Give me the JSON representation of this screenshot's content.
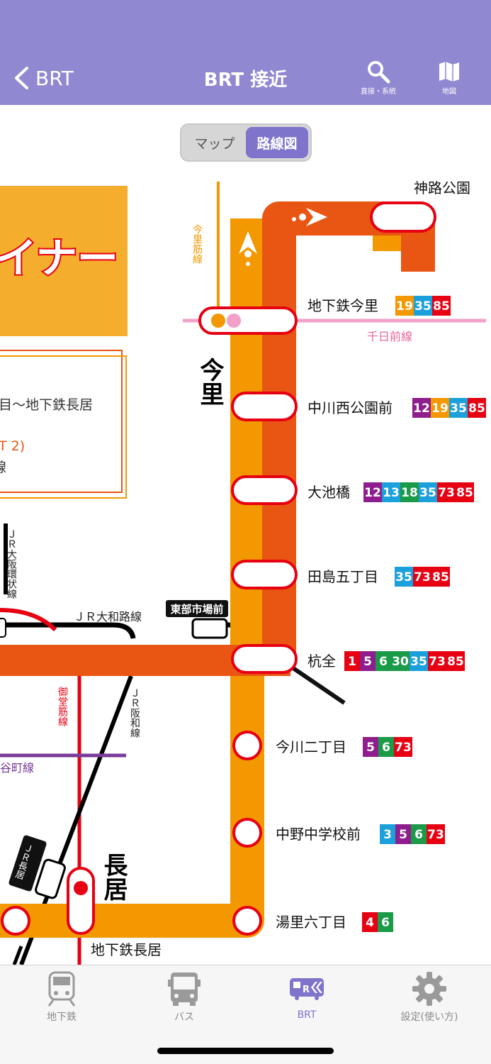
{
  "header": {
    "back_label": "BRT",
    "title": "BRT 接近",
    "search_label": "直接・系統",
    "map_label": "地図"
  },
  "segment": {
    "items": [
      "マップ",
      "路線図"
    ],
    "selected": "路線図"
  },
  "route_map": {
    "line_labels": {
      "imazato_suji": "今里筋線",
      "sennichimae": "千日前線",
      "jr_osaka_loop": "ＪＲ大阪環状線",
      "jr_yamatoji": "ＪＲ大和路線",
      "midosuji": "御堂筋線",
      "jr_hanwa": "ＪＲ阪和線",
      "tanimachi": "谷町線",
      "jr_nagai": "ＪＲ長居"
    },
    "station_names": {
      "imazato": "今里",
      "nagai": "長居",
      "tobu_shijo": "東部市場前"
    },
    "panel_text": {
      "banner": "イナー",
      "line1": "目〜地下鉄長居",
      "line2": "T 2)",
      "line3": "線"
    },
    "stops": [
      {
        "name": "神路公園",
        "routes": []
      },
      {
        "name": "地下鉄今里",
        "routes": [
          "19",
          "35",
          "85"
        ]
      },
      {
        "name": "中川西公園前",
        "routes": [
          "12",
          "19",
          "35",
          "85"
        ]
      },
      {
        "name": "大池橋",
        "routes": [
          "12",
          "13",
          "18",
          "35",
          "73",
          "85"
        ]
      },
      {
        "name": "田島五丁目",
        "routes": [
          "35",
          "73",
          "85"
        ]
      },
      {
        "name": "杭全",
        "routes": [
          "1",
          "5",
          "6",
          "30",
          "35",
          "73",
          "85"
        ]
      },
      {
        "name": "今川二丁目",
        "routes": [
          "5",
          "6",
          "73"
        ]
      },
      {
        "name": "中野中学校前",
        "routes": [
          "3",
          "5",
          "6",
          "73"
        ]
      },
      {
        "name": "湯里六丁目",
        "routes": [
          "4",
          "6"
        ]
      },
      {
        "name": "地下鉄長居",
        "routes": []
      }
    ],
    "route_colors": {
      "1": "#e60012",
      "3": "#1ba0dc",
      "4": "#e60012",
      "5": "#8e1d8e",
      "6": "#1b9a48",
      "12": "#8e1d8e",
      "13": "#1ba0dc",
      "18": "#1b9a48",
      "19": "#f39800",
      "30": "#1b9a48",
      "35": "#1ba0dc",
      "73": "#e60012",
      "85": "#e60012"
    },
    "colors": {
      "orange": "#f39800",
      "dark_orange": "#e95513",
      "red": "#e60012",
      "pink": "#f2a0c8",
      "purple": "#7a3a9a"
    }
  },
  "tabbar": {
    "items": [
      {
        "label": "地下鉄",
        "icon": "subway-icon"
      },
      {
        "label": "バス",
        "icon": "bus-icon"
      },
      {
        "label": "BRT",
        "icon": "brt-icon"
      },
      {
        "label": "設定(使い方)",
        "icon": "gear-icon"
      }
    ],
    "active": "BRT"
  }
}
